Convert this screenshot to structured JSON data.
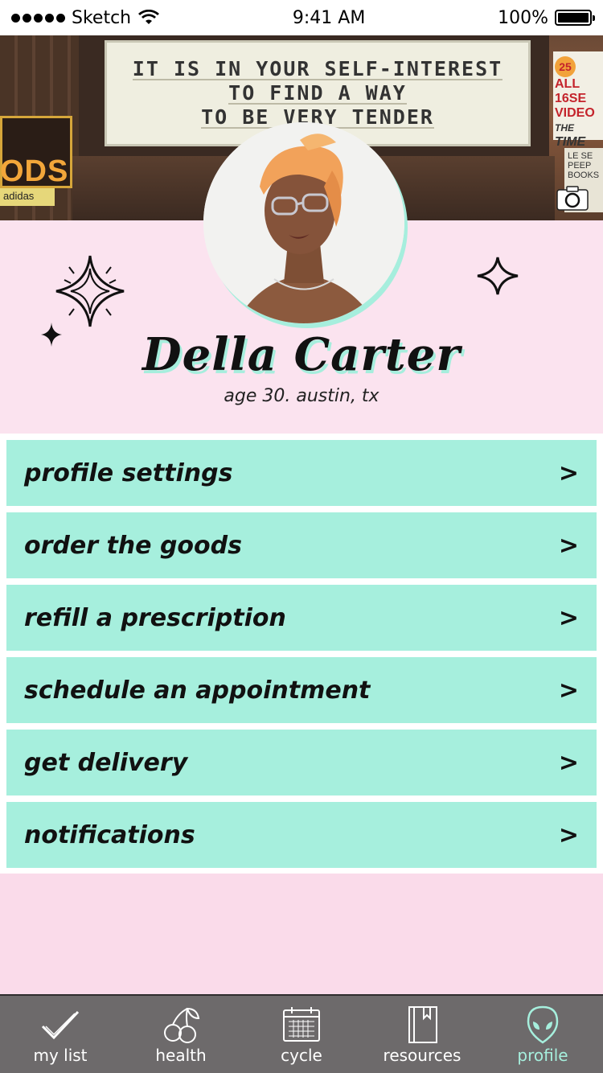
{
  "status_bar": {
    "carrier": "Sketch",
    "time": "9:41 AM",
    "battery": "100%"
  },
  "cover": {
    "marquee_lines": [
      "IT IS IN YOUR SELF-INTEREST",
      "TO FIND A WAY",
      "TO BE VERY TENDER"
    ],
    "left_sign": "ODS",
    "left_small_sign": "adidas",
    "right_sign_badge": "25",
    "right_sign_lines": [
      "ALL",
      "16SE",
      "VIDEO",
      "THE",
      "TIME"
    ],
    "right_low_sign": [
      "LE SE",
      "PEEP",
      "BOOKS"
    ]
  },
  "profile": {
    "name": "Della Carter",
    "subtitle": "age 30. austin, tx"
  },
  "menu": {
    "items": [
      {
        "label": "profile settings",
        "chevron": ">"
      },
      {
        "label": "order the goods",
        "chevron": ">"
      },
      {
        "label": "refill a prescription",
        "chevron": ">"
      },
      {
        "label": "schedule an appointment",
        "chevron": ">"
      },
      {
        "label": "get delivery",
        "chevron": ">"
      },
      {
        "label": "notifications",
        "chevron": ">"
      }
    ]
  },
  "tab_bar": {
    "tabs": [
      {
        "label": "my list",
        "icon": "checkmark-icon",
        "active": false
      },
      {
        "label": "health",
        "icon": "cherry-icon",
        "active": false
      },
      {
        "label": "cycle",
        "icon": "calendar-icon",
        "active": false
      },
      {
        "label": "resources",
        "icon": "book-icon",
        "active": false
      },
      {
        "label": "profile",
        "icon": "alien-icon",
        "active": true
      }
    ]
  },
  "colors": {
    "accent_mint": "#a6efdd",
    "background_pink": "#fbe3ef",
    "tab_bar_gray": "#6d6a6b"
  }
}
